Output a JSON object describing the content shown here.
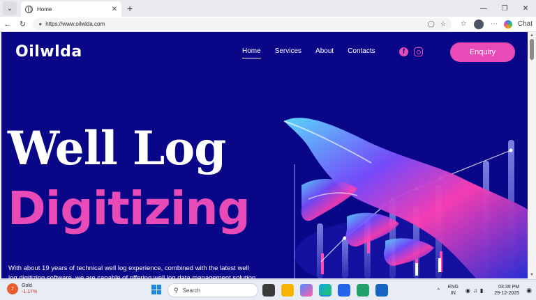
{
  "browser": {
    "tab_title": "Home",
    "url": "https://www.oilwlda.com",
    "chat_label": "Chat"
  },
  "site": {
    "logo": "Oilwlda",
    "nav": [
      {
        "label": "Home",
        "active": true
      },
      {
        "label": "Services",
        "active": false
      },
      {
        "label": "About",
        "active": false
      },
      {
        "label": "Contacts",
        "active": false
      }
    ],
    "enquiry_label": "Enquiry",
    "hero_line1": "Well Log",
    "hero_line2": "Digitizing",
    "description": "With about 19 years of technical well log experience, combined with the latest well log digitizing software, we are capable of offering well log data management solution that adds",
    "colors": {
      "background": "#0a0688",
      "accent": "#e84bb7",
      "text": "#ffffff"
    }
  },
  "taskbar": {
    "weather_label": "Gold",
    "weather_change": "-1.17%",
    "weather_badge": "7",
    "search_placeholder": "Search",
    "lang_top": "ENG",
    "lang_bottom": "IN",
    "time": "03:39 PM",
    "date": "29-12-2025"
  }
}
